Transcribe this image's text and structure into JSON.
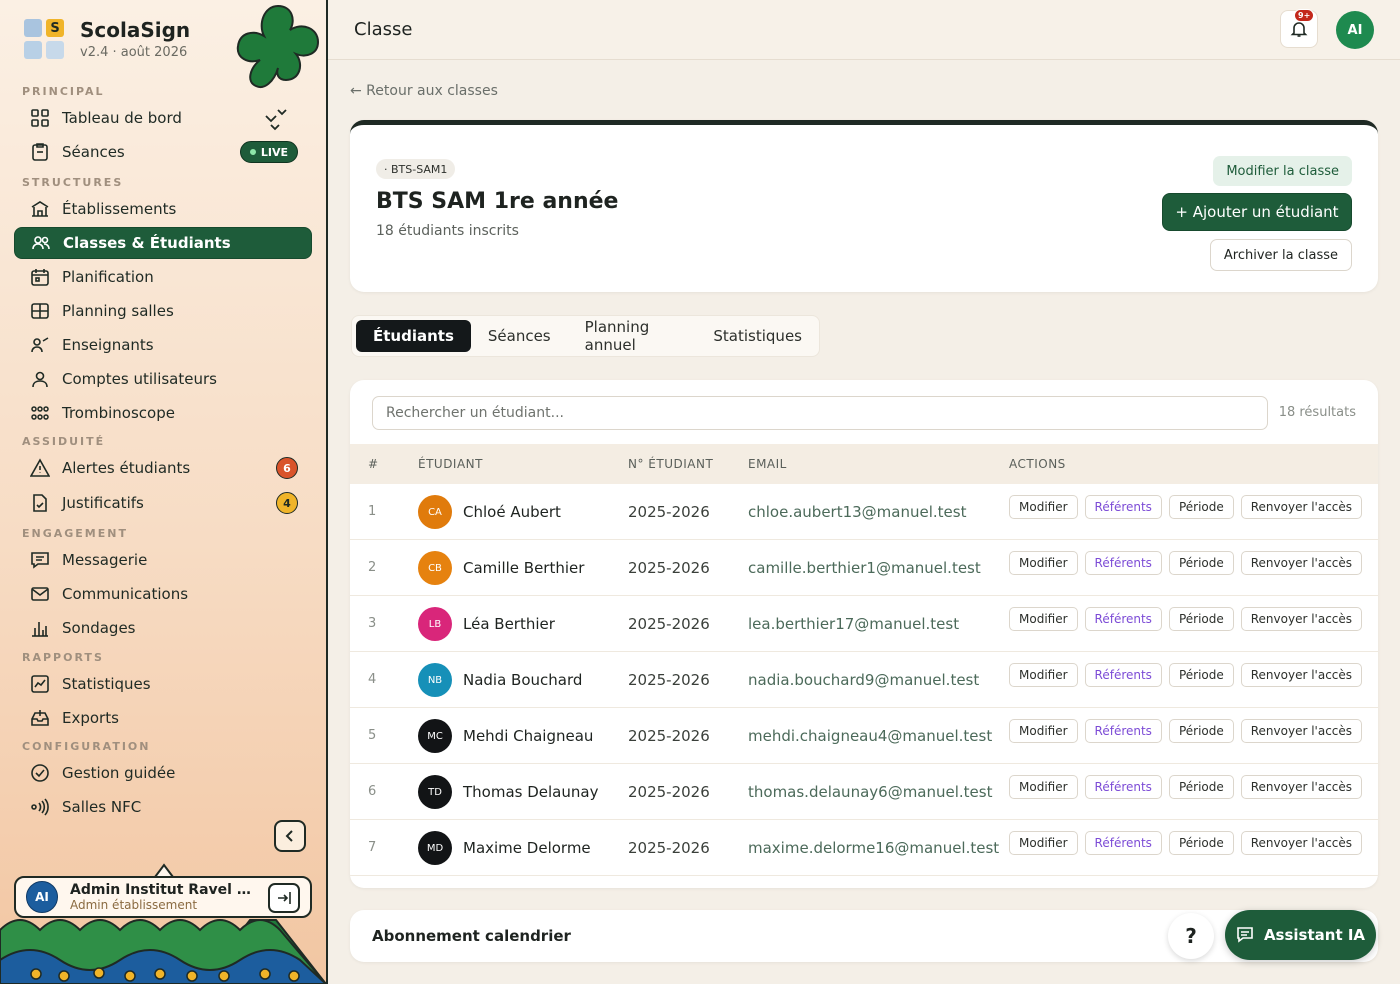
{
  "brand": {
    "name": "ScolaSign",
    "version": "v2.4 · août 2026",
    "logo_letter": "S"
  },
  "sidebar": {
    "sections": {
      "principal": "PRINCIPAL",
      "structures": "STRUCTURES",
      "assiduite": "ASSIDUITÉ",
      "engagement": "ENGAGEMENT",
      "rapports": "RAPPORTS",
      "configuration": "CONFIGURATION"
    },
    "items": [
      {
        "label": "Tableau de bord",
        "icon": "grid-icon"
      },
      {
        "label": "Séances",
        "icon": "clipboard-icon",
        "badge": "LIVE"
      },
      {
        "label": "Établissements",
        "icon": "building-icon"
      },
      {
        "label": "Classes & Étudiants",
        "icon": "users-icon",
        "active": true
      },
      {
        "label": "Planification",
        "icon": "calendar-icon"
      },
      {
        "label": "Planning salles",
        "icon": "layout-icon"
      },
      {
        "label": "Enseignants",
        "icon": "teacher-icon"
      },
      {
        "label": "Comptes utilisateurs",
        "icon": "user-icon"
      },
      {
        "label": "Trombinoscope",
        "icon": "faces-grid-icon"
      },
      {
        "label": "Alertes étudiants",
        "icon": "warning-icon",
        "count": "6"
      },
      {
        "label": "Justificatifs",
        "icon": "file-check-icon",
        "count": "4"
      },
      {
        "label": "Messagerie",
        "icon": "message-icon"
      },
      {
        "label": "Communications",
        "icon": "mail-icon"
      },
      {
        "label": "Sondages",
        "icon": "bar-chart-icon"
      },
      {
        "label": "Statistiques",
        "icon": "line-chart-icon"
      },
      {
        "label": "Exports",
        "icon": "export-icon"
      },
      {
        "label": "Gestion guidée",
        "icon": "check-circle-icon"
      },
      {
        "label": "Salles NFC",
        "icon": "nfc-icon"
      }
    ],
    "user": {
      "initials": "AI",
      "name": "Admin Institut Ravel For...",
      "role": "Admin établissement"
    }
  },
  "topbar": {
    "title": "Classe",
    "notif_badge": "9+",
    "avatar": "AI"
  },
  "main": {
    "back_link": "← Retour aux classes",
    "class": {
      "code": "· BTS-SAM1",
      "title": "BTS SAM 1re année",
      "subtitle": "18 étudiants inscrits",
      "edit_label": "Modifier la classe",
      "add_label": "+  Ajouter un étudiant",
      "archive_label": "Archiver la classe"
    },
    "tabs": [
      "Étudiants",
      "Séances",
      "Planning annuel",
      "Statistiques"
    ],
    "search": {
      "placeholder": "Rechercher un étudiant...",
      "results": "18 résultats"
    },
    "columns": [
      "#",
      "ÉTUDIANT",
      "N° ÉTUDIANT",
      "EMAIL",
      "ACTIONS"
    ],
    "actions": [
      "Modifier",
      "Référents",
      "Période",
      "Renvoyer l'accès"
    ],
    "students": [
      {
        "n": "1",
        "initials": "CA",
        "color": "#e07b0c",
        "name": "Chloé Aubert",
        "id": "2025-2026",
        "email": "chloe.aubert13@manuel.test"
      },
      {
        "n": "2",
        "initials": "CB",
        "color": "#e6820f",
        "name": "Camille Berthier",
        "id": "2025-2026",
        "email": "camille.berthier1@manuel.test"
      },
      {
        "n": "3",
        "initials": "LB",
        "color": "#d9267a",
        "name": "Léa Berthier",
        "id": "2025-2026",
        "email": "lea.berthier17@manuel.test"
      },
      {
        "n": "4",
        "initials": "NB",
        "color": "#1690b8",
        "name": "Nadia Bouchard",
        "id": "2025-2026",
        "email": "nadia.bouchard9@manuel.test"
      },
      {
        "n": "5",
        "initials": "MC",
        "color": "#121416",
        "name": "Mehdi Chaigneau",
        "id": "2025-2026",
        "email": "mehdi.chaigneau4@manuel.test"
      },
      {
        "n": "6",
        "initials": "TD",
        "color": "#121416",
        "name": "Thomas Delaunay",
        "id": "2025-2026",
        "email": "thomas.delaunay6@manuel.test"
      },
      {
        "n": "7",
        "initials": "MD",
        "color": "#121416",
        "name": "Maxime Delorme",
        "id": "2025-2026",
        "email": "maxime.delorme16@manuel.test"
      }
    ],
    "calendar": {
      "title": "Abonnement calendrier"
    },
    "help_label": "?",
    "assistant_label": "Assistant IA"
  }
}
